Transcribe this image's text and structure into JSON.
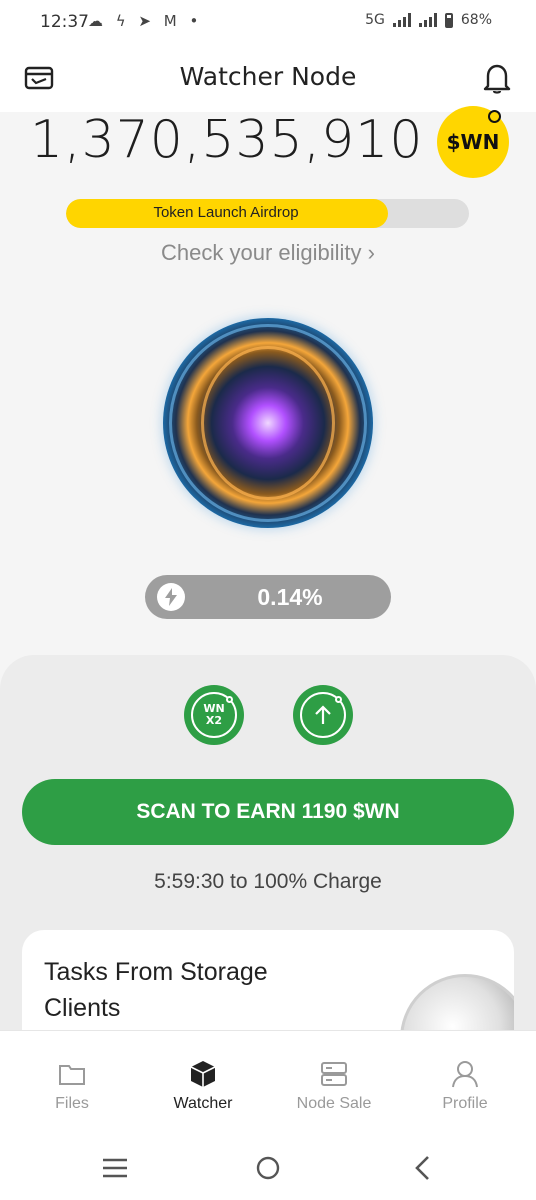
{
  "status_bar": {
    "time": "12:37",
    "left_icons": "☁ ϟ ➤ M •",
    "network": "5G",
    "battery": "68%"
  },
  "header": {
    "title": "Watcher Node"
  },
  "balance": {
    "amount": "1,370,535,910",
    "token_badge": "$WN"
  },
  "airdrop": {
    "label": "Token Launch Airdrop",
    "progress": 0.8
  },
  "eligibility_link": "Check your eligibility ›",
  "charge": {
    "value": "0.14%"
  },
  "boosts": {
    "multiplier_line1": "WN",
    "multiplier_line2": "X2"
  },
  "scan_button": "SCAN TO EARN 1190 $WN",
  "timer": "5:59:30 to 100% Charge",
  "tasks_card": {
    "title": "Tasks From Storage Clients"
  },
  "bottom_nav": [
    {
      "label": "Files",
      "icon": "folder-icon",
      "active": false
    },
    {
      "label": "Watcher",
      "icon": "cube-icon",
      "active": true
    },
    {
      "label": "Node Sale",
      "icon": "server-icon",
      "active": false
    },
    {
      "label": "Profile",
      "icon": "user-icon",
      "active": false
    }
  ],
  "colors": {
    "accent_green": "#2e9e45",
    "accent_yellow": "#ffd500"
  }
}
